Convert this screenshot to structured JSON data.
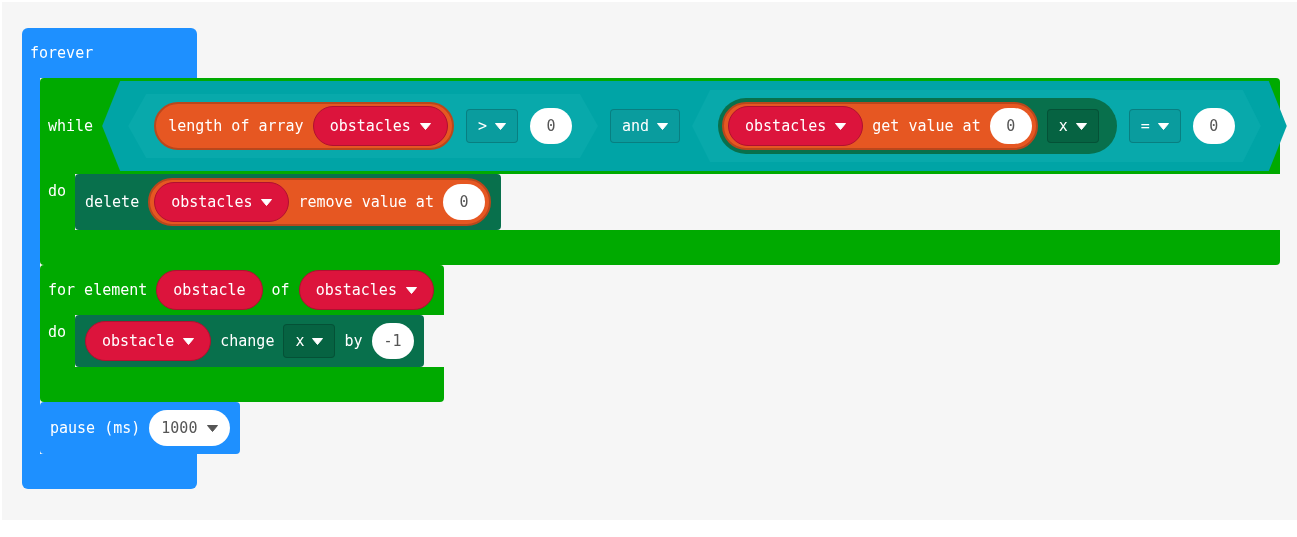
{
  "program": {
    "kind": "forever",
    "parts": [
      {
        "kind": "text",
        "text": "forever"
      }
    ],
    "body": [
      {
        "kind": "while",
        "parts": [
          {
            "kind": "text",
            "text": "while"
          },
          {
            "kind": "logic",
            "parts": [
              {
                "kind": "logic",
                "parts": [
                  {
                    "kind": "reporter",
                    "parts": [
                      {
                        "kind": "text",
                        "text": "length of array"
                      },
                      {
                        "kind": "var",
                        "text": "obstacles"
                      }
                    ]
                  },
                  {
                    "kind": "dropdown",
                    "text": ">"
                  },
                  {
                    "kind": "number",
                    "text": "0"
                  }
                ]
              },
              {
                "kind": "dropdown",
                "text": "and"
              },
              {
                "kind": "logic",
                "parts": [
                  {
                    "kind": "property",
                    "parts": [
                      {
                        "kind": "reporter",
                        "parts": [
                          {
                            "kind": "var",
                            "text": "obstacles"
                          },
                          {
                            "kind": "text",
                            "text": "get value at"
                          },
                          {
                            "kind": "number",
                            "text": "0"
                          }
                        ]
                      },
                      {
                        "kind": "dropdown",
                        "text": "x"
                      }
                    ]
                  },
                  {
                    "kind": "dropdown",
                    "text": "="
                  },
                  {
                    "kind": "number",
                    "text": "0"
                  }
                ]
              }
            ]
          }
        ],
        "do_label": "do",
        "body": [
          {
            "kind": "sprite",
            "parts": [
              {
                "kind": "text",
                "text": "delete"
              },
              {
                "kind": "reporter",
                "parts": [
                  {
                    "kind": "var",
                    "text": "obstacles"
                  },
                  {
                    "kind": "text",
                    "text": "remove value at"
                  },
                  {
                    "kind": "number",
                    "text": "0"
                  }
                ]
              }
            ]
          }
        ]
      },
      {
        "kind": "for",
        "parts": [
          {
            "kind": "text",
            "text": "for element"
          },
          {
            "kind": "varname",
            "text": "obstacle"
          },
          {
            "kind": "text",
            "text": "of"
          },
          {
            "kind": "var",
            "text": "obstacles"
          }
        ],
        "do_label": "do",
        "body": [
          {
            "kind": "sprite",
            "parts": [
              {
                "kind": "var",
                "text": "obstacle"
              },
              {
                "kind": "text",
                "text": "change"
              },
              {
                "kind": "dropdown",
                "text": "x"
              },
              {
                "kind": "text",
                "text": "by"
              },
              {
                "kind": "number",
                "text": "-1"
              }
            ]
          }
        ]
      },
      {
        "kind": "basic",
        "parts": [
          {
            "kind": "text",
            "text": "pause (ms)"
          },
          {
            "kind": "numdrop",
            "text": "1000"
          }
        ]
      }
    ]
  }
}
